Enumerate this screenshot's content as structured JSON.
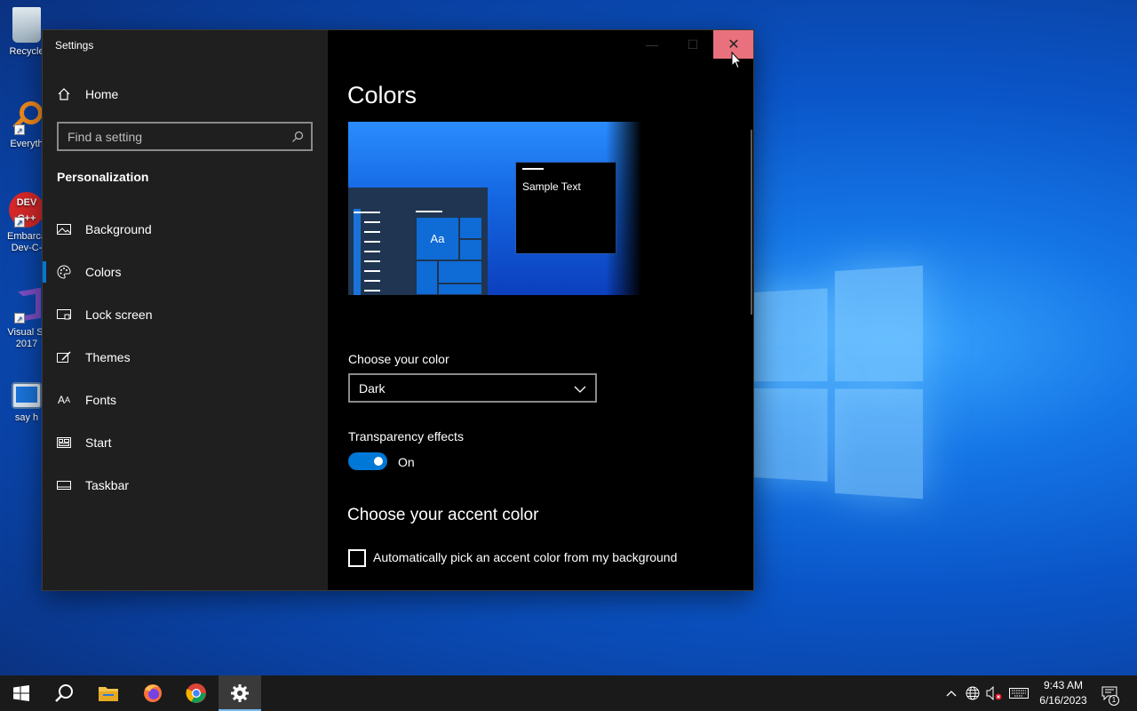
{
  "desktop": {
    "icons": [
      {
        "label": "Recycle"
      },
      {
        "label": "Everyth"
      },
      {
        "label": "Embarca Dev-C-"
      },
      {
        "label": "Visual St 2017"
      },
      {
        "label": "say h"
      }
    ]
  },
  "window": {
    "title": "Settings",
    "minimize_glyph": "—",
    "maximize_glyph": "☐",
    "close_glyph": "✕"
  },
  "sidebar": {
    "home_label": "Home",
    "search_placeholder": "Find a setting",
    "section_title": "Personalization",
    "items": [
      {
        "label": "Background",
        "icon": "picture-icon"
      },
      {
        "label": "Colors",
        "icon": "palette-icon",
        "active": true
      },
      {
        "label": "Lock screen",
        "icon": "lock-screen-icon"
      },
      {
        "label": "Themes",
        "icon": "brush-icon"
      },
      {
        "label": "Fonts",
        "icon": "font-icon"
      },
      {
        "label": "Start",
        "icon": "start-icon"
      },
      {
        "label": "Taskbar",
        "icon": "taskbar-icon"
      }
    ]
  },
  "content": {
    "title": "Colors",
    "preview": {
      "sample_text": "Sample Text",
      "tile_text": "Aa"
    },
    "choose_color_label": "Choose your color",
    "choose_color_value": "Dark",
    "transparency_label": "Transparency effects",
    "transparency_state": "On",
    "accent_heading": "Choose your accent color",
    "auto_accent_label": "Automatically pick an accent color from my background"
  },
  "taskbar": {
    "apps": [
      {
        "name": "start-button"
      },
      {
        "name": "search-button"
      },
      {
        "name": "file-explorer"
      },
      {
        "name": "firefox"
      },
      {
        "name": "chrome"
      },
      {
        "name": "settings",
        "active": true
      }
    ],
    "time": "9:43 AM",
    "date": "6/16/2023",
    "notification_count": "1"
  },
  "colors": {
    "accent": "#0078d7",
    "close_hover": "#e8717d",
    "sidebar_bg": "#1f1f1f",
    "content_bg": "#000000"
  }
}
